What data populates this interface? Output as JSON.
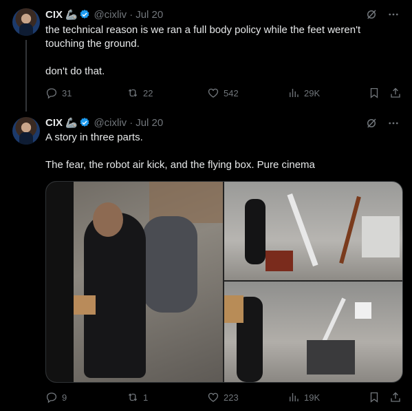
{
  "tweets": [
    {
      "name": "CIX",
      "emoji": "🦾",
      "handle": "@cixliv",
      "sep": "·",
      "date": "Jul 20",
      "text_lines": [
        "the technical reason is we ran a full body policy while the feet weren't",
        "touching the ground.",
        "",
        "don't do that."
      ],
      "replies": "31",
      "retweets": "22",
      "likes": "542",
      "views": "29K"
    },
    {
      "name": "CIX",
      "emoji": "🦾",
      "handle": "@cixliv",
      "sep": "·",
      "date": "Jul 20",
      "text_lines": [
        "A story in three parts.",
        "",
        "The fear, the robot air kick, and the flying box. Pure cinema"
      ],
      "replies": "9",
      "retweets": "1",
      "likes": "223",
      "views": "19K"
    }
  ],
  "colors": {
    "verified": "#1d9bf0",
    "muted": "#71767b",
    "text": "#e7e9ea",
    "background": "#000000"
  },
  "icons": [
    "grok-icon",
    "more-icon",
    "reply-icon",
    "retweet-icon",
    "like-icon",
    "views-icon",
    "bookmark-icon",
    "share-icon"
  ]
}
